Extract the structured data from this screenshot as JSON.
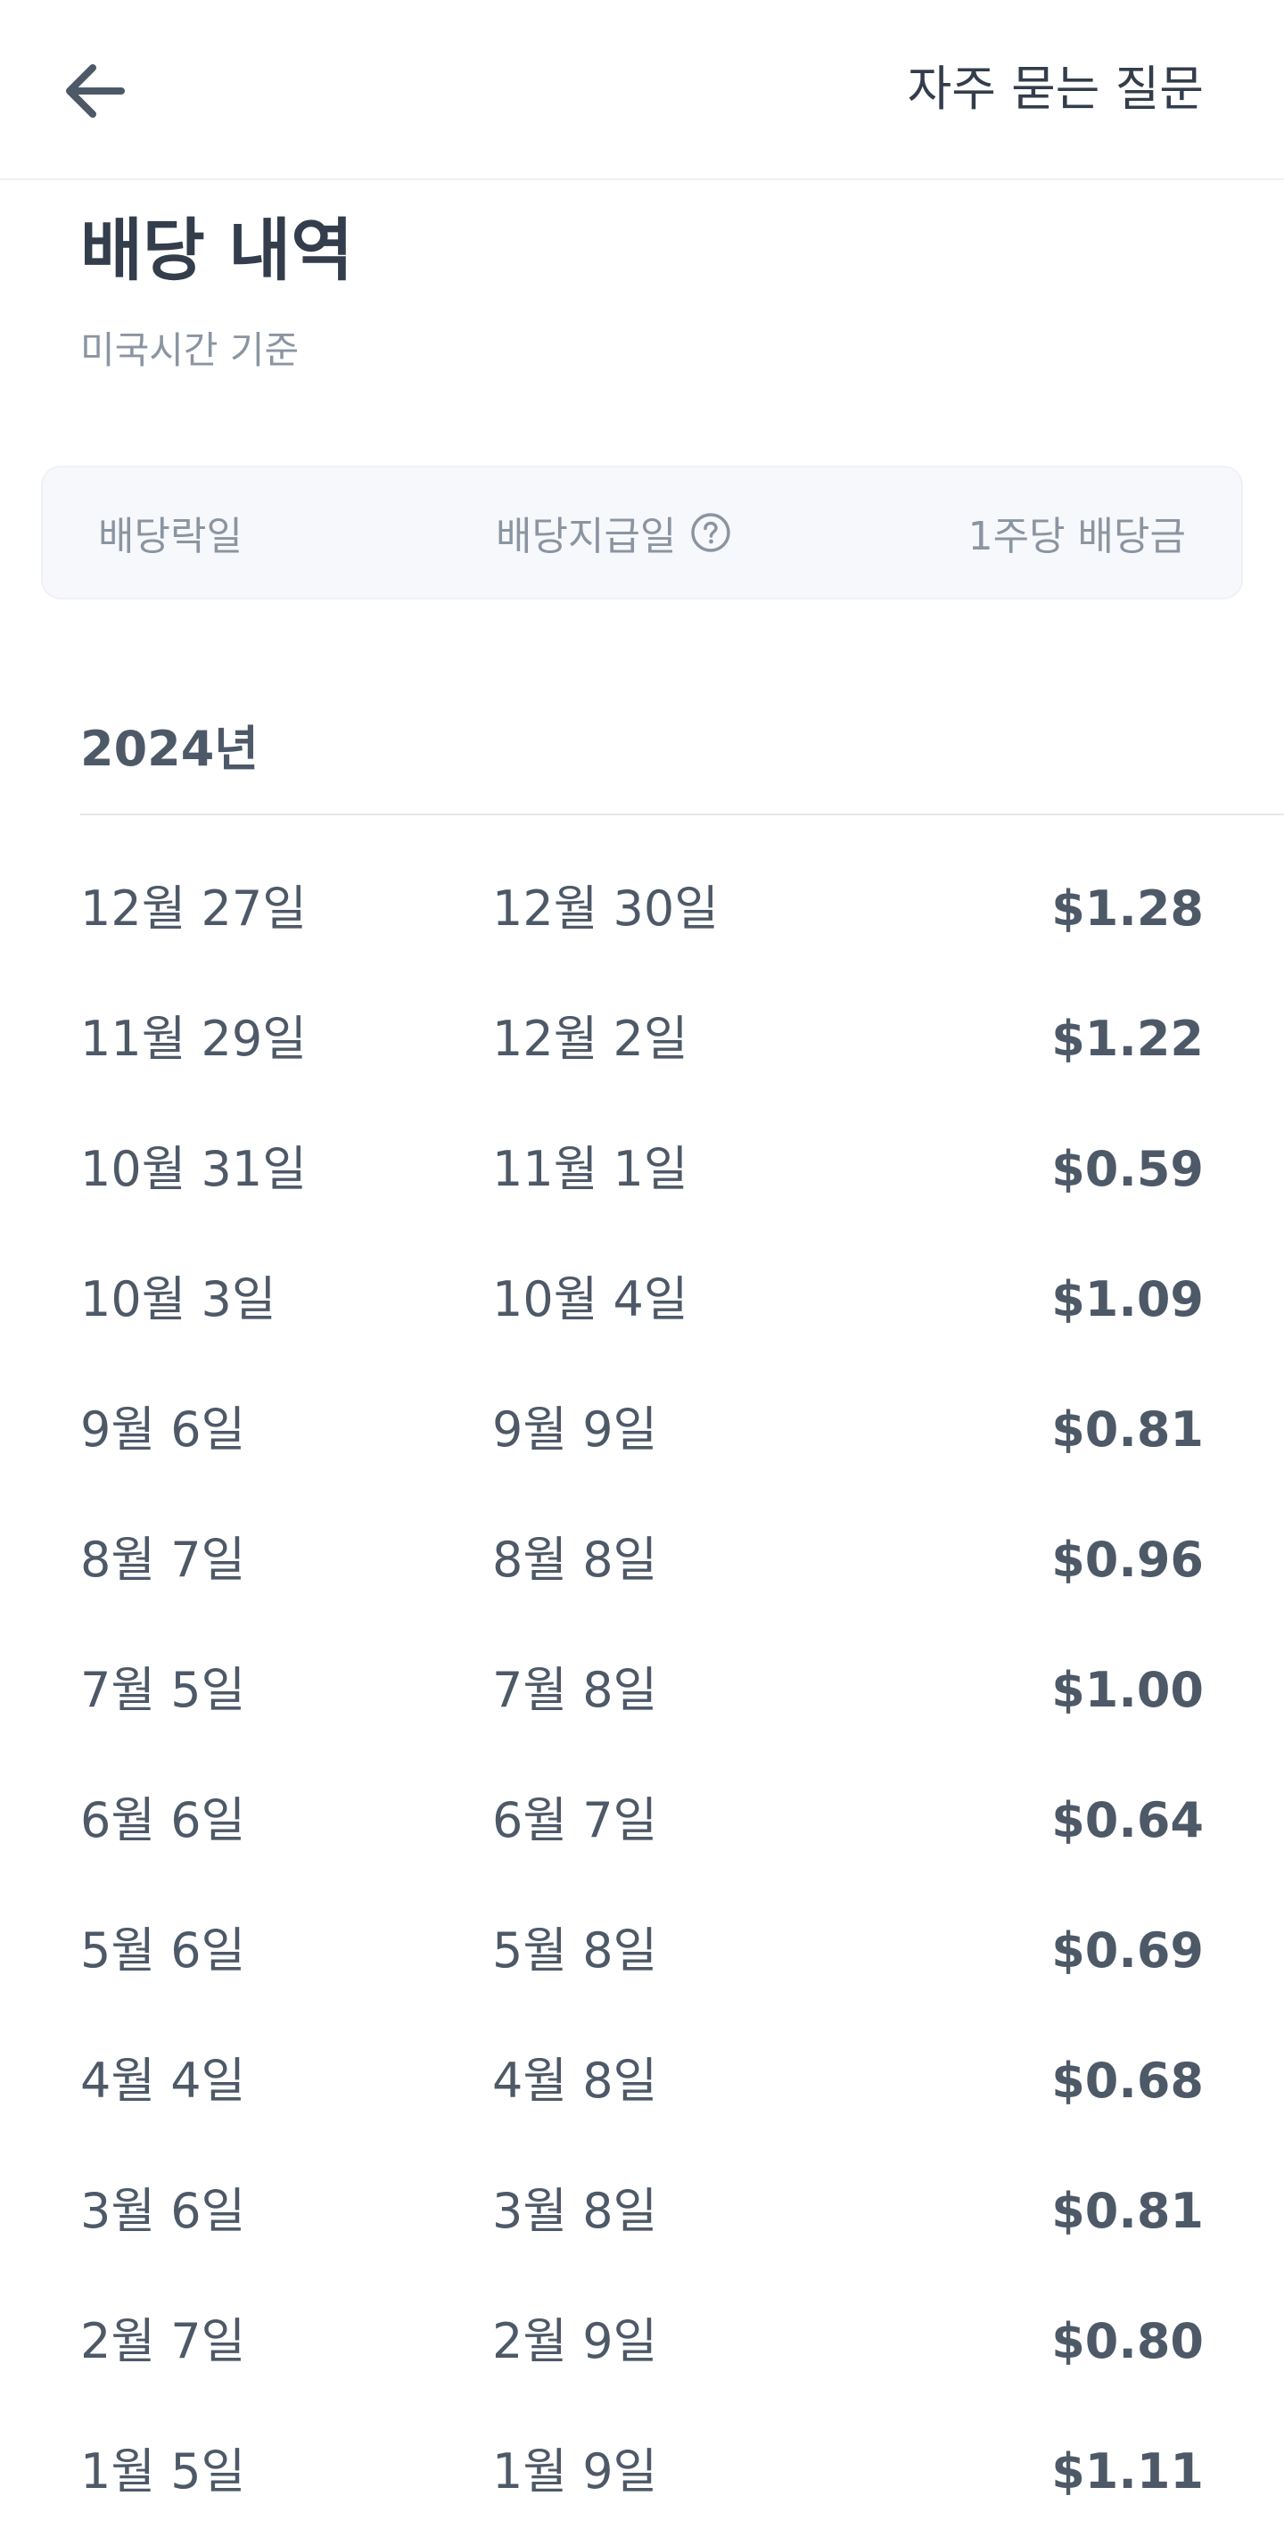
{
  "header": {
    "back_icon": "arrow-left-icon",
    "faq_label": "자주 묻는 질문"
  },
  "section": {
    "title": "배당 내역",
    "subtitle": "미국시간 기준"
  },
  "table_header": {
    "ex_date": "배당락일",
    "pay_date": "배당지급일",
    "help_icon": "question-circle-icon",
    "per_share": "1주당 배당금"
  },
  "year": "2024년",
  "rows": [
    {
      "ex_date": "12월 27일",
      "pay_date": "12월 30일",
      "amount": "$1.28"
    },
    {
      "ex_date": "11월 29일",
      "pay_date": "12월 2일",
      "amount": "$1.22"
    },
    {
      "ex_date": "10월 31일",
      "pay_date": "11월 1일",
      "amount": "$0.59"
    },
    {
      "ex_date": "10월 3일",
      "pay_date": "10월 4일",
      "amount": "$1.09"
    },
    {
      "ex_date": "9월 6일",
      "pay_date": "9월 9일",
      "amount": "$0.81"
    },
    {
      "ex_date": "8월 7일",
      "pay_date": "8월 8일",
      "amount": "$0.96"
    },
    {
      "ex_date": "7월 5일",
      "pay_date": "7월 8일",
      "amount": "$1.00"
    },
    {
      "ex_date": "6월 6일",
      "pay_date": "6월 7일",
      "amount": "$0.64"
    },
    {
      "ex_date": "5월 6일",
      "pay_date": "5월 8일",
      "amount": "$0.69"
    },
    {
      "ex_date": "4월 4일",
      "pay_date": "4월 8일",
      "amount": "$0.68"
    },
    {
      "ex_date": "3월 6일",
      "pay_date": "3월 8일",
      "amount": "$0.81"
    },
    {
      "ex_date": "2월 7일",
      "pay_date": "2월 9일",
      "amount": "$0.80"
    },
    {
      "ex_date": "1월 5일",
      "pay_date": "1월 9일",
      "amount": "$1.11"
    }
  ]
}
